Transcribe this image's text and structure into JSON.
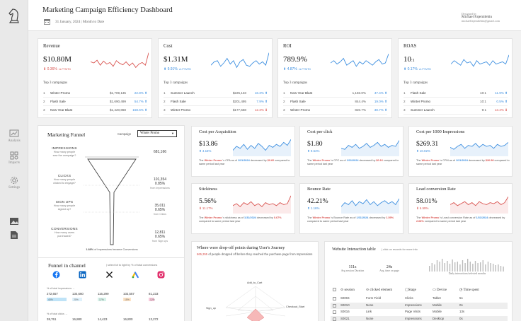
{
  "header": {
    "title": "Marketing Campaign Efficiency Dashboard",
    "date": "31 January, 2024 | Month to Date",
    "designed_by": "Designed by",
    "designer_name": "Michael Fajemilehin",
    "designer_email": "michaelfajemilehin@gmail.com"
  },
  "sidebar": {
    "items": [
      {
        "label": "Analysis",
        "icon": "chart-icon"
      },
      {
        "label": "Impacts",
        "icon": "grid-icon"
      },
      {
        "label": "Settings",
        "icon": "gear-icon"
      }
    ]
  },
  "kpis": [
    {
      "title": "Revenue",
      "value": "$10.80M",
      "change": "0.36%",
      "vs": "vs PYMTD",
      "top_label": "Top 3 campaigns",
      "trend": "down",
      "color": "#d9534f",
      "spark": [
        0.55,
        0.5,
        0.62,
        0.4,
        0.58,
        0.45,
        0.52,
        0.35,
        0.6,
        0.48,
        0.42,
        0.55,
        0.38,
        0.5,
        0.3,
        0.45,
        0.52,
        0.4,
        0.95
      ],
      "rows": [
        {
          "n": "1",
          "name": "Winter Promo",
          "value": "$1,709,135",
          "pct": "22.8%",
          "dir": "up"
        },
        {
          "n": "2",
          "name": "Flash Sale",
          "value": "$1,690,499",
          "pct": "54.7%",
          "dir": "up"
        },
        {
          "n": "3",
          "name": "New Year Blast",
          "value": "$1,420,868",
          "pct": "158.6%",
          "dir": "up"
        }
      ]
    },
    {
      "title": "Cost",
      "value": "$1.31M",
      "change": "9.91%",
      "vs": "vs PYMTD",
      "top_label": "Top 3 campaigns",
      "trend": "up",
      "color": "#3d8fe0",
      "spark": [
        0.4,
        0.55,
        0.6,
        0.35,
        0.5,
        0.7,
        0.45,
        0.6,
        0.3,
        0.55,
        0.65,
        0.4,
        0.35,
        0.5,
        0.6,
        0.45,
        0.55,
        0.4,
        0.95
      ],
      "rows": [
        {
          "n": "1",
          "name": "Summer Launch",
          "value": "$225,133",
          "pct": "16.3%",
          "dir": "up"
        },
        {
          "n": "2",
          "name": "Flash Sale",
          "value": "$201,495",
          "pct": "7.9%",
          "dir": "up"
        },
        {
          "n": "3",
          "name": "Winter Promo",
          "value": "$177,568",
          "pct": "12.3%",
          "dir": "down"
        }
      ]
    },
    {
      "title": "ROI",
      "value": "789.9%",
      "change": "4.87%",
      "vs": "vs PYMTD",
      "top_label": "Top 3 campaigns",
      "trend": "up",
      "color": "#3d8fe0",
      "spark": [
        0.5,
        0.6,
        0.45,
        0.55,
        0.7,
        0.4,
        0.5,
        0.6,
        0.35,
        0.55,
        0.45,
        0.6,
        0.5,
        0.4,
        0.55,
        0.65,
        0.45,
        0.5,
        0.9
      ],
      "rows": [
        {
          "n": "1",
          "name": "New Year Blast",
          "value": "1,183.0%",
          "pct": "47.4%",
          "dir": "up"
        },
        {
          "n": "2",
          "name": "Flash Sale",
          "value": "844.4%",
          "pct": "19.0%",
          "dir": "up"
        },
        {
          "n": "3",
          "name": "Winter Promo",
          "value": "820.7%",
          "pct": "30.7%",
          "dir": "up"
        }
      ]
    },
    {
      "title": "ROAS",
      "value": "10",
      "value_suffix": ":1",
      "change": "0.17%",
      "vs": "vs PYMTD",
      "top_label": "Top 3 campaigns",
      "trend": "up",
      "color": "#3d8fe0",
      "spark": [
        0.45,
        0.6,
        0.5,
        0.4,
        0.65,
        0.5,
        0.55,
        0.35,
        0.6,
        0.45,
        0.5,
        0.55,
        0.4,
        0.6,
        0.45,
        0.5,
        0.55,
        0.45,
        0.85
      ],
      "rows": [
        {
          "n": "1",
          "name": "Flash Sale",
          "value": "10:1",
          "pct": "11.9%",
          "dir": "up"
        },
        {
          "n": "2",
          "name": "Winter Promo",
          "value": "10:1",
          "pct": "0.5%",
          "dir": "up"
        },
        {
          "n": "3",
          "name": "Summer Launch",
          "value": "9:1",
          "pct": "13.4%",
          "dir": "down"
        }
      ]
    }
  ],
  "metrics": [
    {
      "title": "Cost per Acquisition",
      "value": "$13.86",
      "change": "4.15%",
      "trend": "up",
      "color": "#3d8fe0",
      "note_pre": "The",
      "note_camp": "Winter Promo",
      "note_mid": "'s CPA as of",
      "note_date": "1/31/2024",
      "note_dir": "decreased by",
      "note_val": "$0.60",
      "note_end": "compared to same period last year",
      "spark": [
        0.3,
        0.5,
        0.4,
        0.6,
        0.35,
        0.55,
        0.4,
        0.65,
        0.5,
        0.3,
        0.55,
        0.45,
        0.6,
        0.5,
        0.7,
        0.55,
        0.85
      ]
    },
    {
      "title": "Cost per click",
      "value": "$1.80",
      "change": "9.64%",
      "trend": "up",
      "color": "#3d8fe0",
      "note_pre": "The",
      "note_camp": "Winter Promo",
      "note_mid": "'s CPC as of",
      "note_date": "1/31/2024",
      "note_dir": "decreased by",
      "note_val": "$0.16",
      "note_end": "compared to same period last year",
      "spark": [
        0.4,
        0.35,
        0.55,
        0.45,
        0.6,
        0.4,
        0.5,
        0.65,
        0.45,
        0.55,
        0.7,
        0.5,
        0.6,
        0.45,
        0.55,
        0.5,
        0.8
      ]
    },
    {
      "title": "Cost per 1000 Impressions",
      "value": "$269.31",
      "change": "10.02%",
      "trend": "up",
      "color": "#3d8fe0",
      "note_pre": "The",
      "note_camp": "Winter Promo",
      "note_mid": "'s CPM as of",
      "note_date": "1/31/2024",
      "note_dir": "decreased by",
      "note_val": "$26.98",
      "note_end": "compared to same period last year",
      "spark": [
        0.45,
        0.35,
        0.5,
        0.6,
        0.4,
        0.55,
        0.5,
        0.65,
        0.45,
        0.6,
        0.5,
        0.55,
        0.4,
        0.6,
        0.5,
        0.55,
        0.7
      ]
    },
    {
      "title": "Stickiness",
      "value": "5.56%",
      "change": "11.17%",
      "trend": "down",
      "color": "#d9534f",
      "note_pre": "The",
      "note_camp": "Winter Promo",
      "note_mid": "'s stickiness as of",
      "note_date": "1/31/2024",
      "note_dir": "decreased by",
      "note_val": "0.67%",
      "note_end": "compared to same period last year",
      "spark": [
        0.4,
        0.5,
        0.35,
        0.55,
        0.45,
        0.6,
        0.4,
        0.5,
        0.35,
        0.55,
        0.45,
        0.5,
        0.4,
        0.55,
        0.45,
        0.5,
        0.9
      ]
    },
    {
      "title": "Bounce Rate",
      "value": "42.21%",
      "change": "1.16%",
      "trend": "up",
      "color": "#3d8fe0",
      "note_pre": "The",
      "note_camp": "Winter Promo",
      "note_mid": "'s Bounce Rate as of",
      "note_date": "1/31/2024",
      "note_dir": "decreased by",
      "note_val": "1.59%",
      "note_end": "compared to same period last year",
      "spark": [
        0.35,
        0.55,
        0.45,
        0.65,
        0.4,
        0.6,
        0.5,
        0.7,
        0.45,
        0.6,
        0.4,
        0.55,
        0.65,
        0.5,
        0.6,
        0.45,
        0.75
      ]
    },
    {
      "title": "Lead conversion Rate",
      "value": "58.01%",
      "change": "6.59%",
      "trend": "down",
      "color": "#d9534f",
      "note_pre": "The",
      "note_camp": "Winter Promo",
      "note_mid": "'s Lead conversion Rate as of",
      "note_date": "1/31/2024",
      "note_dir": "decreased by",
      "note_val": "2.68%",
      "note_end": "compared to same period last year",
      "spark": [
        0.45,
        0.55,
        0.4,
        0.5,
        0.6,
        0.45,
        0.55,
        0.4,
        0.6,
        0.5,
        0.45,
        0.55,
        0.5,
        0.6,
        0.45,
        0.55,
        0.85
      ]
    }
  ],
  "funnel": {
    "title": "Marketing Funnel",
    "campaign_label": "Campaign",
    "campaign_value": "Winter Promo",
    "stages": [
      {
        "name": "IMPRESSIONS",
        "q1": "How many people",
        "q2": "saw the campaign?",
        "value": "681,166",
        "pct": "",
        "sub": ""
      },
      {
        "name": "CLICKS",
        "q1": "How many people",
        "q2": "clicked to engage?",
        "value": "101,354",
        "pct": "0.85%",
        "sub": "from Impressions"
      },
      {
        "name": "SIGN UPS",
        "q1": "How many people",
        "q2": "signed up?",
        "value": "35,011",
        "pct": "0.65%",
        "sub": "from Clicks"
      },
      {
        "name": "CONVERSIONS",
        "q1": "How many users",
        "q2": "purchased?",
        "value": "12,811",
        "pct": "0.65%",
        "sub": "from Sign ups"
      }
    ],
    "footer_value": "1.88%",
    "footer_text": "of Impressions became Conversions"
  },
  "channel": {
    "title": "Funnel in channel",
    "subtitle": "| select kit to light by % of total conversions",
    "icons": [
      "facebook-icon",
      "linkedin-icon",
      "x-icon",
      "google-ads-icon",
      "instagram-icon"
    ],
    "impr_label": "% of total impressions →",
    "impr_values": [
      "272,657",
      "134,660",
      "116,299",
      "102,557",
      "81,233"
    ],
    "impr_pcts": [
      "40%",
      "20%",
      "17%",
      "15%",
      "12%"
    ],
    "clicks_label": "% of total clicks →",
    "clicks_values": [
      "38,761",
      "16,880",
      "14,423",
      "16,800",
      "13,272"
    ]
  },
  "dropoff": {
    "title": "Where were drop-off points during User's Journey",
    "highlight": "665,355",
    "text": "of people dropped off before they reached the purchase page from Impressions",
    "labels": [
      "Add_to_Cart",
      "Checkout_Start",
      "Sign_up"
    ]
  },
  "interaction": {
    "title": "Website Interaction table",
    "subtitle": "| click on records for more info",
    "stats": [
      {
        "value": "111s",
        "label": "Avg session Duration"
      },
      {
        "value": "24s",
        "label": "Avg. time on page"
      }
    ],
    "bars_label": "Daily interactions/selected months",
    "bars": [
      0.4,
      0.6,
      0.5,
      0.8,
      0.7,
      0.9,
      0.6,
      0.75,
      0.55,
      0.85,
      0.65,
      0.7,
      0.5,
      0.8,
      0.6,
      0.9,
      0.7,
      0.55,
      0.75,
      0.6,
      0.65,
      0.8,
      0.5,
      0.7,
      0.6,
      0.55,
      0.45,
      0.5,
      0.4,
      0.35
    ],
    "columns": [
      "session",
      "clicked element",
      "Stage",
      "Device",
      "Time spent"
    ],
    "rows": [
      {
        "session": "S0004",
        "element": "Form Field",
        "stage": "Clicks",
        "device": "Tablet",
        "time": "5s"
      },
      {
        "session": "S0010",
        "element": "None",
        "stage": "Impressions",
        "device": "Mobile",
        "time": "0s"
      },
      {
        "session": "S0016",
        "element": "Link",
        "stage": "Page Visits",
        "device": "Mobile",
        "time": "13s"
      },
      {
        "session": "S0021",
        "element": "None",
        "stage": "Impressions",
        "device": "Desktop",
        "time": "0s"
      }
    ]
  }
}
